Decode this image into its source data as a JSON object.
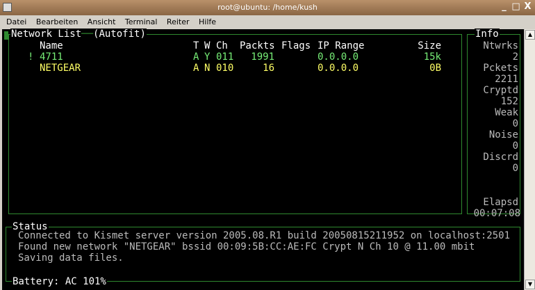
{
  "window": {
    "title": "root@ubuntu: /home/kush",
    "minimize": "_",
    "maximize": "□",
    "close": "X"
  },
  "menu": [
    "Datei",
    "Bearbeiten",
    "Ansicht",
    "Terminal",
    "Reiter",
    "Hilfe"
  ],
  "network_list": {
    "title": "Network List",
    "mode": "(Autofit)",
    "headers": {
      "name": "Name",
      "t": "T",
      "w": "W",
      "ch": "Ch",
      "packets": "Packts",
      "flags": "Flags",
      "ip": "IP Range",
      "size": "Size"
    },
    "rows": [
      {
        "marker": "!",
        "name": "4711",
        "t": "A",
        "w": "Y",
        "ch": "011",
        "packets": "1991",
        "flags": "",
        "ip": "0.0.0.0",
        "size": "15k",
        "color": "#77ee77"
      },
      {
        "marker": "",
        "name": "NETGEAR",
        "t": "A",
        "w": "N",
        "ch": "010",
        "packets": "16",
        "flags": "",
        "ip": "0.0.0.0",
        "size": "0B",
        "color": "#ffff66"
      }
    ]
  },
  "info": {
    "title": "Info",
    "items": [
      {
        "label": "Ntwrks",
        "value": "2"
      },
      {
        "label": "Pckets",
        "value": "2211"
      },
      {
        "label": "Cryptd",
        "value": "152"
      },
      {
        "label": "Weak",
        "value": "0"
      },
      {
        "label": "Noise",
        "value": "0"
      },
      {
        "label": "Discrd",
        "value": "0"
      }
    ],
    "elapsed_label": "Elapsd",
    "elapsed": "00:07:08"
  },
  "status": {
    "title": "Status",
    "lines": [
      "Connected to Kismet server version 2005.08.R1 build 20050815211952 on localhost:2501",
      "Found new network \"NETGEAR\" bssid 00:09:5B:CC:AE:FC Crypt N Ch 10 @ 11.00 mbit",
      "Saving data files."
    ],
    "battery": "Battery: AC 101%"
  }
}
